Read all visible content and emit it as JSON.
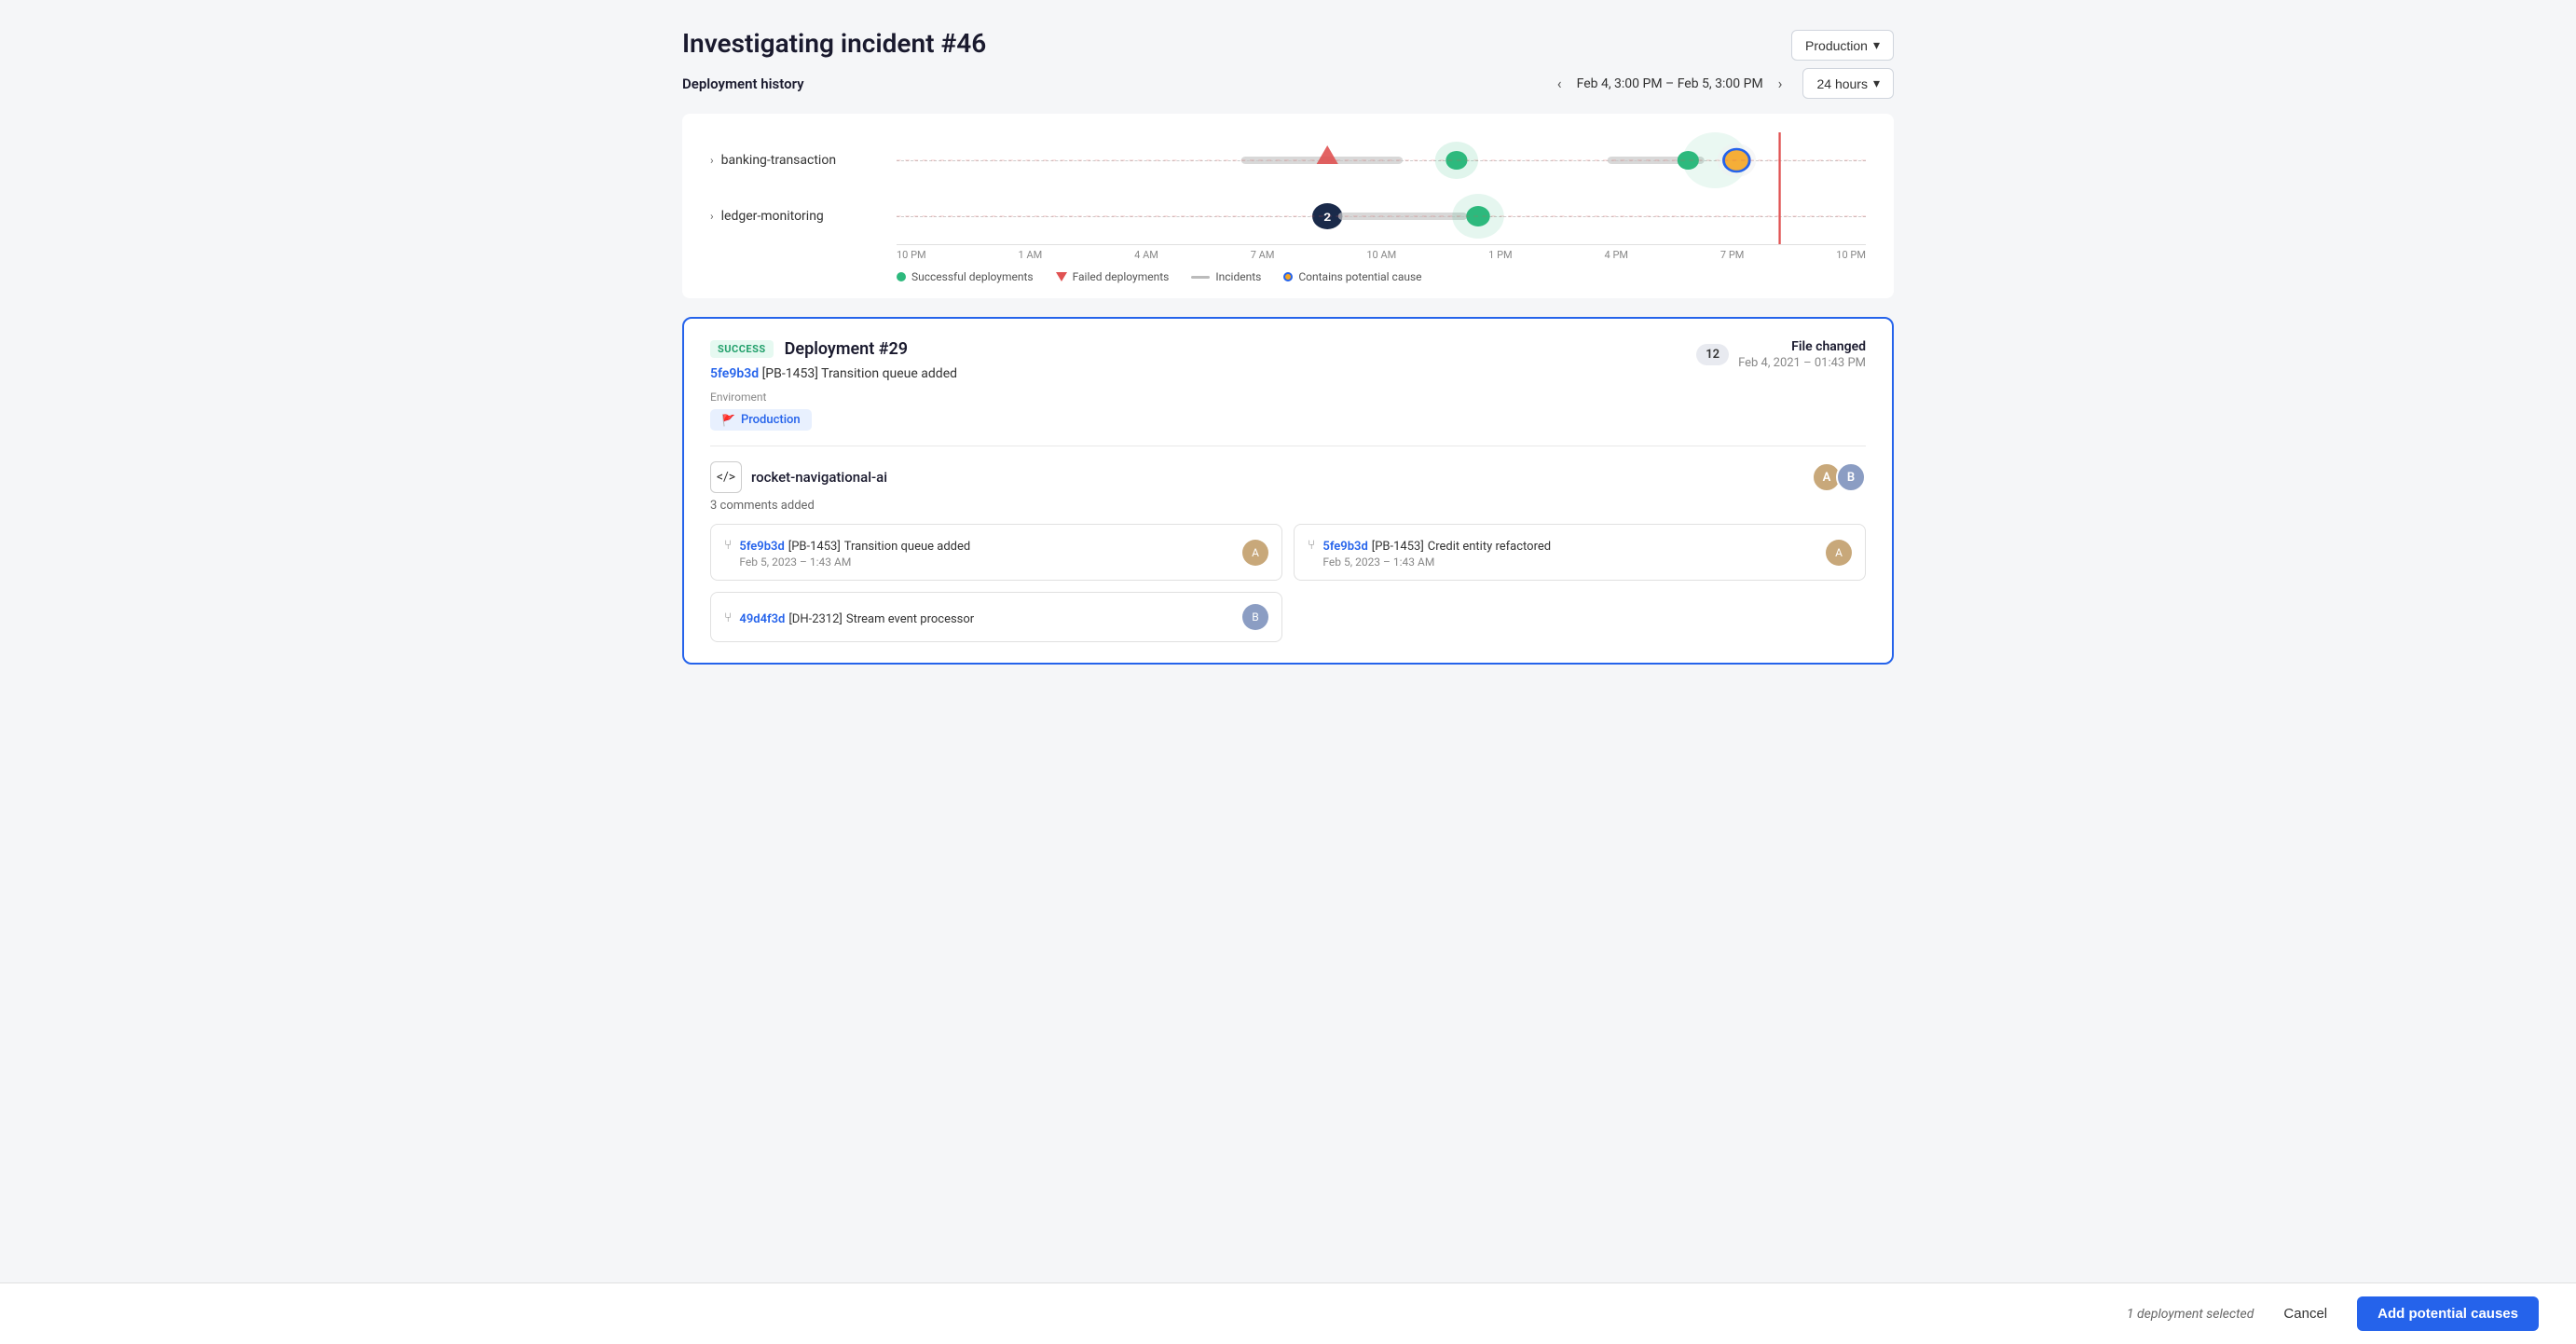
{
  "page": {
    "title": "Investigating incident #46",
    "section_label": "Deployment history"
  },
  "header": {
    "date_range": "Feb 4, 3:00 PM – Feb 5, 3:00 PM",
    "timeframe_label": "24 hours",
    "environment_label": "Production"
  },
  "chart": {
    "x_axis_labels": [
      "10 PM",
      "1 AM",
      "4 AM",
      "7 AM",
      "10 AM",
      "1 PM",
      "4 PM",
      "7 PM",
      "10 PM"
    ],
    "services": [
      {
        "name": "banking-transaction"
      },
      {
        "name": "ledger-monitoring"
      }
    ],
    "legend": {
      "successful": "Successful deployments",
      "failed": "Failed deployments",
      "incidents": "Incidents",
      "potential_cause": "Contains potential cause"
    }
  },
  "deployment_card": {
    "status": "SUCCESS",
    "title": "Deployment #29",
    "commit_line": "5fe9b3d [PB-1453] Transition queue added",
    "commit_hash": "5fe9b3d",
    "commit_ticket": "[PB-1453]",
    "commit_message": "Transition queue added",
    "env_label": "Enviroment",
    "env_name": "Production",
    "file_count": "12",
    "file_changed_label": "File changed",
    "file_date": "Feb 4, 2021 – 01:43 PM",
    "service": {
      "name": "rocket-navigational-ai",
      "comments": "3 comments added"
    },
    "commits": [
      {
        "hash": "5fe9b3d",
        "ticket": "[PB-1453]",
        "message": "Transition queue added",
        "date": "Feb 5, 2023 – 1:43 AM",
        "avatar_initials": "A"
      },
      {
        "hash": "5fe9b3d",
        "ticket": "[PB-1453]",
        "message": "Credit entity refactored",
        "date": "Feb 5, 2023 – 1:43 AM",
        "avatar_initials": "A"
      },
      {
        "hash": "49d4f3d",
        "ticket": "[DH-2312]",
        "message": "Stream event processor",
        "date": "",
        "avatar_initials": "B"
      }
    ]
  },
  "bottom_bar": {
    "selected_text": "1 deployment selected",
    "cancel_label": "Cancel",
    "add_causes_label": "Add potential causes"
  }
}
